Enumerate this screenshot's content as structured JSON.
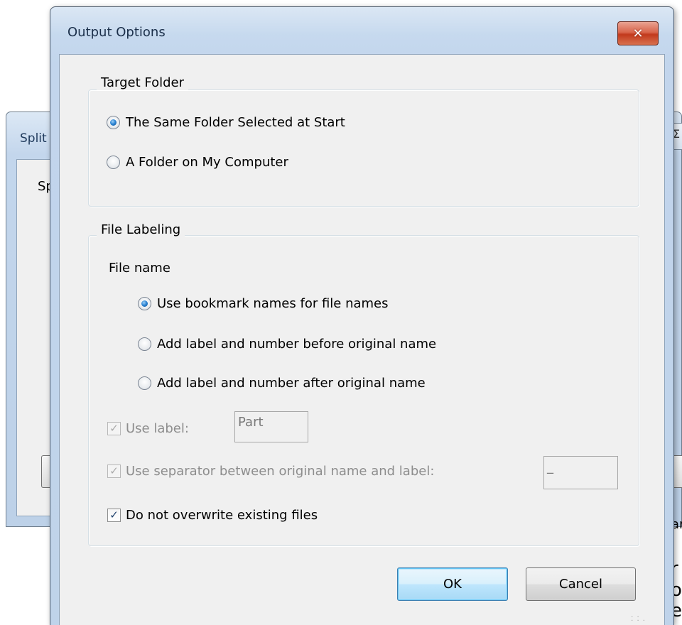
{
  "background_window": {
    "title_fragment": "Split",
    "close_fragment": "Σ",
    "body_fragment": "Sp",
    "right_fragments": [
      "ar",
      "r o",
      "er"
    ]
  },
  "dialog": {
    "title": "Output Options",
    "close_glyph": "✕"
  },
  "target_folder": {
    "legend": "Target Folder",
    "options": [
      {
        "label": "The Same Folder Selected at Start",
        "checked": true
      },
      {
        "label": "A Folder on My Computer",
        "checked": false
      }
    ]
  },
  "file_labeling": {
    "legend": "File Labeling",
    "file_name_label": "File name",
    "options": [
      {
        "label": "Use bookmark names for file names",
        "checked": true
      },
      {
        "label": "Add label and number before original name",
        "checked": false
      },
      {
        "label": "Add label and number after original name",
        "checked": false
      }
    ],
    "use_label": {
      "label": "Use label:",
      "checked": true,
      "enabled": false,
      "value": "Part"
    },
    "use_separator": {
      "label": "Use separator between original name and label:",
      "checked": true,
      "enabled": false,
      "value": "_"
    },
    "no_overwrite": {
      "label": "Do not overwrite existing files",
      "checked": true,
      "enabled": true
    }
  },
  "buttons": {
    "ok": "OK",
    "cancel": "Cancel"
  },
  "icons": {
    "close": "close-icon",
    "checkmark": "✓",
    "grip": "resize-grip-icon"
  }
}
